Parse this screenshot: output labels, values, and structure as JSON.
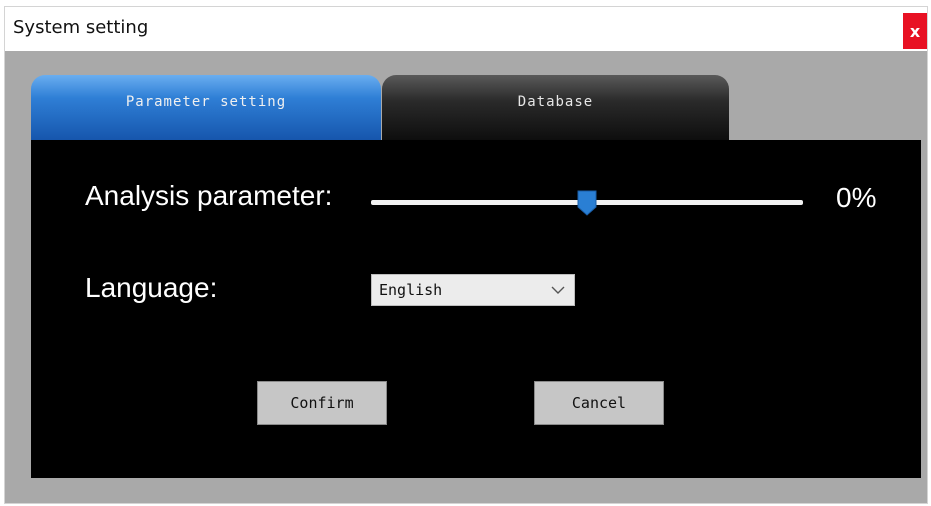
{
  "window": {
    "title": "System setting",
    "close_label": "x"
  },
  "tabs": [
    {
      "label": "Parameter setting",
      "active": true
    },
    {
      "label": "Database",
      "active": false
    }
  ],
  "analysis": {
    "label": "Analysis parameter:",
    "value_text": "0%",
    "slider_position": 0.5
  },
  "language": {
    "label": "Language:",
    "selected": "English"
  },
  "buttons": {
    "confirm": "Confirm",
    "cancel": "Cancel"
  },
  "colors": {
    "active_tab": "#1f6fc8",
    "inactive_tab": "#1a1a1a",
    "panel": "#000000",
    "slider_thumb": "#2a7fd4",
    "close_button": "#e81123"
  }
}
